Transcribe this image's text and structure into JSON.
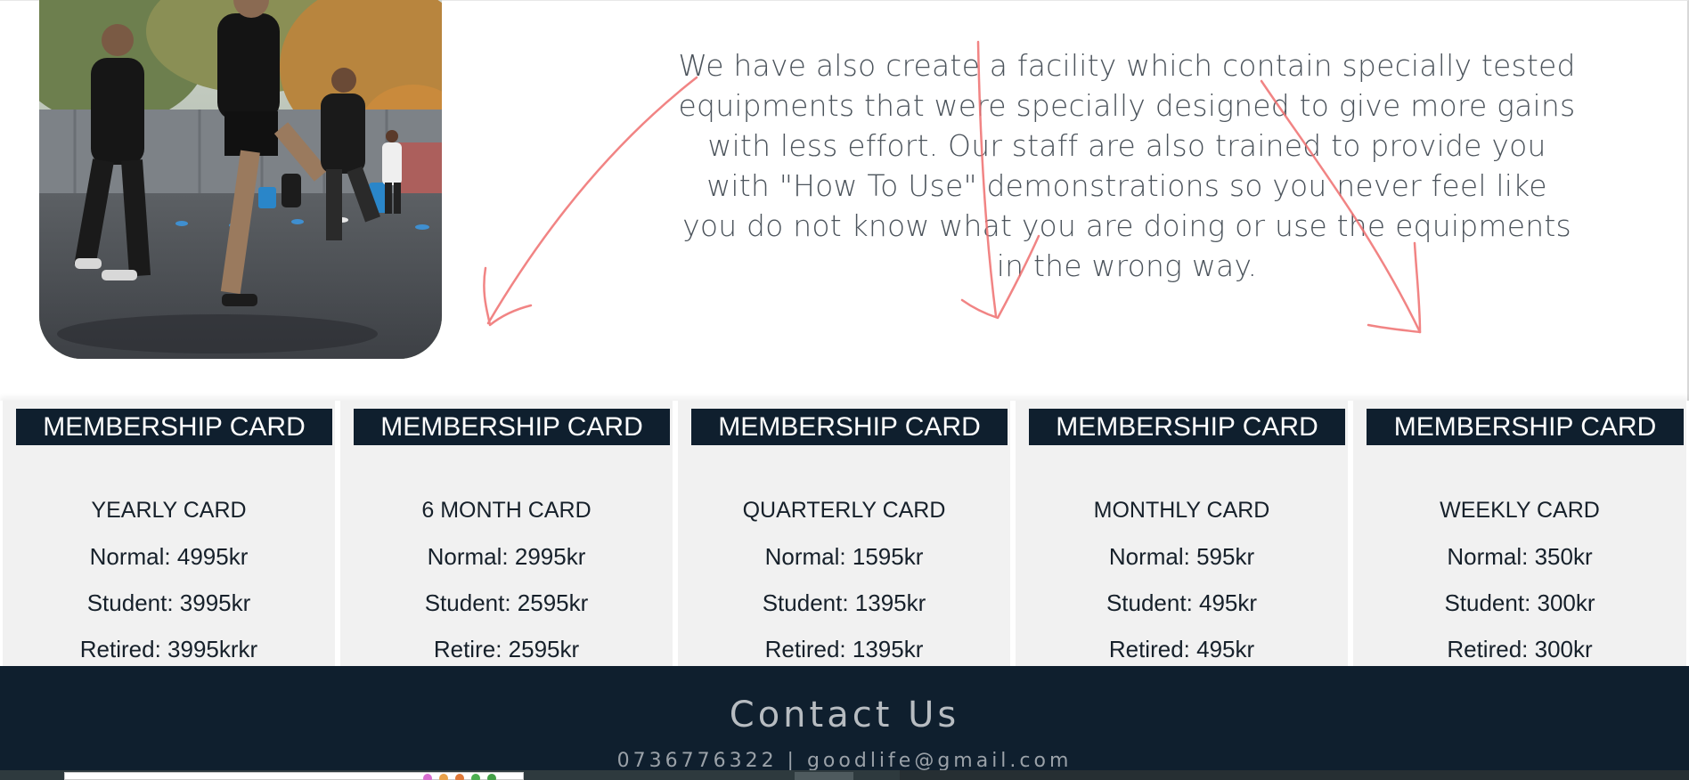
{
  "facility": {
    "text": "We have also create a facility which contain specially tested equipments that were specially designed to give more gains with less effort. Our staff are also trained to provide you with \"How To Use\" demonstrations so you never feel like you do not know what you are doing or use the equipments in the wrong way."
  },
  "membership_cards": [
    {
      "header": "MEMBERSHIP CARD",
      "type": "YEARLY CARD",
      "normal": "Normal: 4995kr",
      "student": "Student: 3995kr",
      "retired": "Retired: 3995krkr"
    },
    {
      "header": "MEMBERSHIP CARD",
      "type": "6 MONTH CARD",
      "normal": "Normal: 2995kr",
      "student": "Student: 2595kr",
      "retired": "Retire: 2595kr"
    },
    {
      "header": "MEMBERSHIP CARD",
      "type": "QUARTERLY CARD",
      "normal": "Normal: 1595kr",
      "student": "Student: 1395kr",
      "retired": "Retired: 1395kr"
    },
    {
      "header": "MEMBERSHIP CARD",
      "type": "MONTHLY CARD",
      "normal": "Normal: 595kr",
      "student": "Student: 495kr",
      "retired": "Retired: 495kr"
    },
    {
      "header": "MEMBERSHIP CARD",
      "type": "WEEKLY CARD",
      "normal": "Normal: 350kr",
      "student": "Student: 300kr",
      "retired": "Retired: 300kr"
    }
  ],
  "footer": {
    "title": "Contact Us",
    "contact_line": "0736776322 | goodlife@gmail.com"
  },
  "colors": {
    "navy": "#0f1f2e",
    "card_background": "#f1f1f1",
    "body_text": "#4c545c",
    "annotation_arrow": "#ef6f6f"
  },
  "icons": {
    "photo": "outdoor-training-group-photo",
    "annotation": "hand-drawn-arrow"
  }
}
